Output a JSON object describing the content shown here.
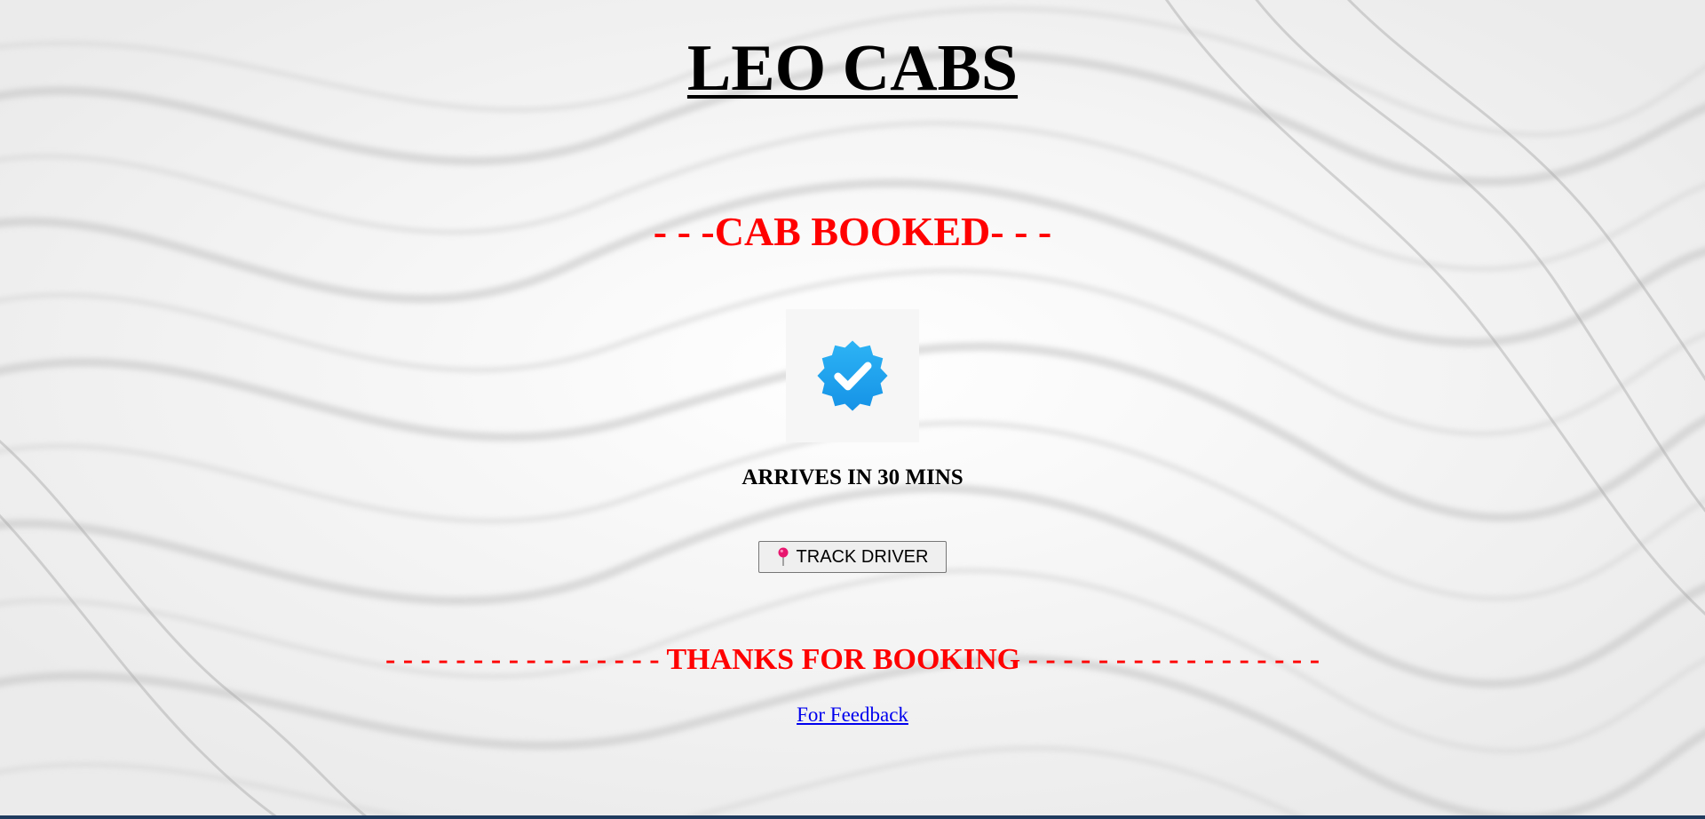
{
  "header": {
    "title": "LEO CABS"
  },
  "status": {
    "heading": "- - -CAB BOOKED- - -",
    "badge_icon": "verified-check-badge-icon",
    "badge_color": "#1da1f2",
    "eta_text": "ARRIVES IN 30 MINS"
  },
  "actions": {
    "track_driver_label": "TRACK DRIVER",
    "track_driver_icon": "round-pushpin-icon"
  },
  "footer": {
    "thanks_text": "- - - - - - - - - - - - - - - - THANKS FOR BOOKING - - - - - - - - - - - - - - - - -",
    "feedback_link": "For Feedback"
  },
  "colors": {
    "accent_red": "#ff0000",
    "link_blue": "#0000ee",
    "bottom_strip": "#1f3b5e"
  }
}
